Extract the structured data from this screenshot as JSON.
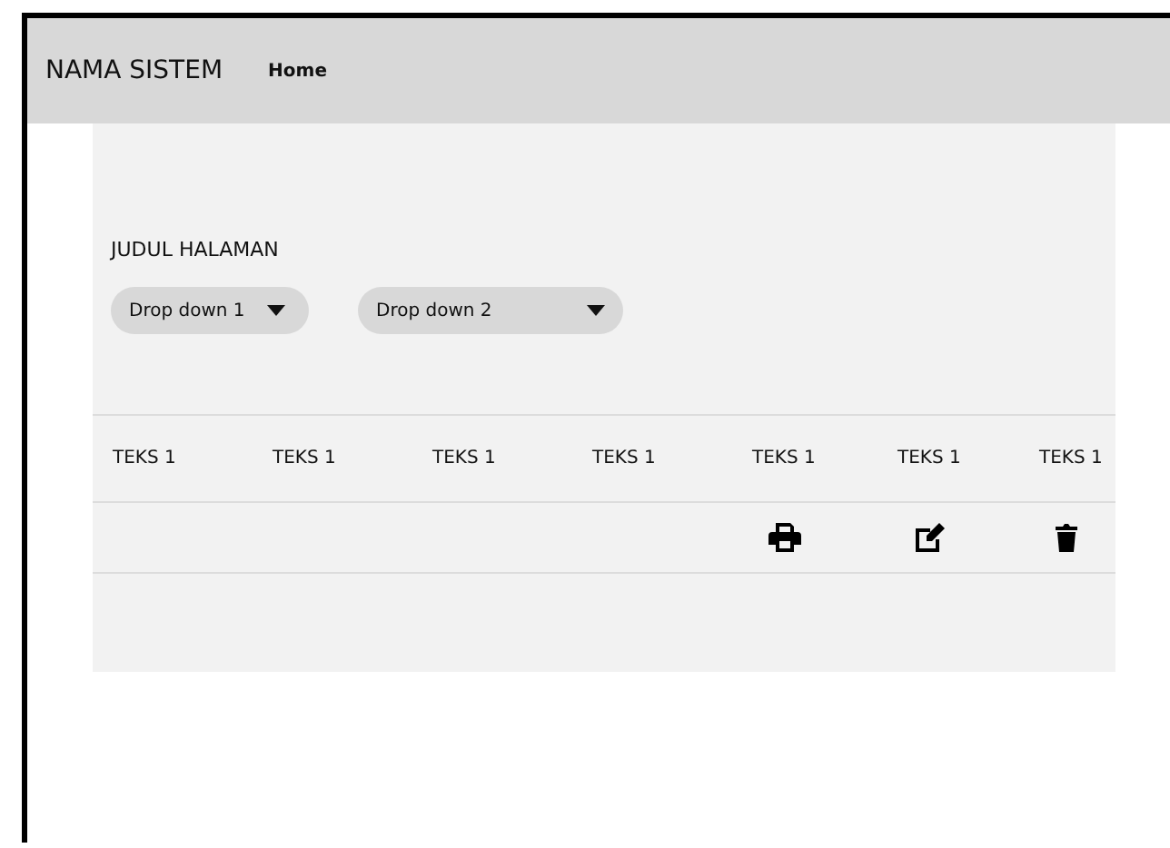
{
  "header": {
    "title": "NAMA SISTEM",
    "nav": [
      "Home"
    ]
  },
  "page_title": "JUDUL HALAMAN",
  "dropdowns": [
    "Drop down 1",
    "Drop down 2"
  ],
  "table": {
    "columns": [
      "TEKS 1",
      "TEKS 1",
      "TEKS 1",
      "TEKS 1",
      "TEKS 1",
      "TEKS 1",
      "TEKS 1"
    ],
    "rows": [
      {
        "actions": [
          {
            "kind": "print"
          },
          {
            "kind": "edit"
          },
          {
            "kind": "delete"
          }
        ]
      }
    ]
  }
}
